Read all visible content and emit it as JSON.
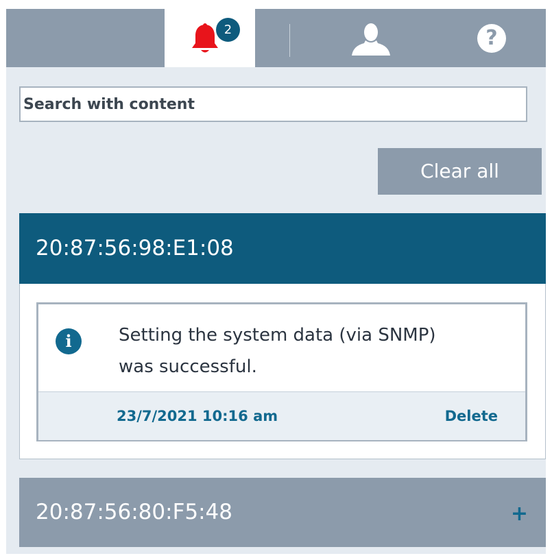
{
  "topbar": {
    "tabs": [
      {
        "name": "notifications",
        "icon": "bell-icon",
        "active": true,
        "badge_count": "2"
      },
      {
        "name": "user",
        "icon": "user-icon",
        "active": false
      },
      {
        "name": "help",
        "icon": "help-icon",
        "glyph": "?",
        "active": false
      }
    ]
  },
  "search": {
    "placeholder": "Search with content",
    "value": ""
  },
  "actions": {
    "clear_all_label": "Clear all"
  },
  "groups": [
    {
      "title": "20:87:56:98:E1:08",
      "expanded": true,
      "messages": [
        {
          "icon": "info-icon",
          "icon_glyph": "i",
          "text_line1": "Setting the system data (via SNMP)",
          "text_line2": "was successful.",
          "timestamp": "23/7/2021 10:16 am",
          "delete_label": "Delete"
        }
      ]
    },
    {
      "title": "20:87:56:80:F5:48",
      "expanded": false,
      "expand_glyph": "+"
    }
  ],
  "colors": {
    "accent": "#0e5b7d",
    "bar_gray": "#8c9bab",
    "bell_red": "#e8141b",
    "panel_bg": "#e5ebf1"
  }
}
